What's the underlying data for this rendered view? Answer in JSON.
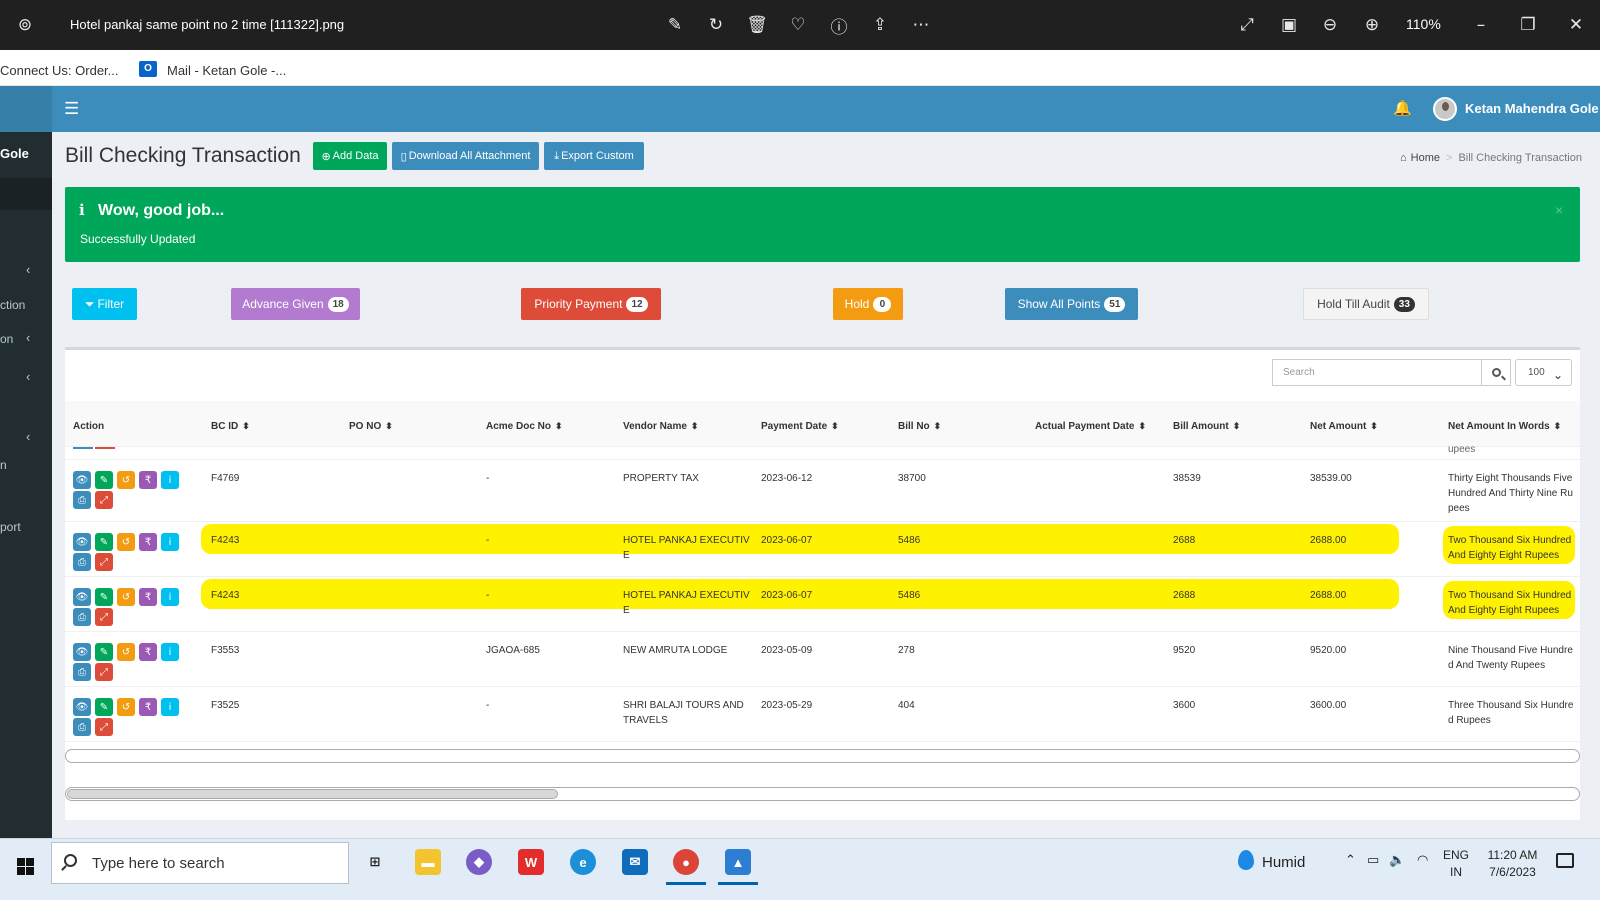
{
  "viewer": {
    "file_name": "Hotel pankaj same point no 2 time [111322].png",
    "zoom": "110%"
  },
  "bookmarks": [
    {
      "label": "Connect Us: Order..."
    },
    {
      "label": "Mail - Ketan Gole -..."
    }
  ],
  "sidebar": {
    "user_label": "Gole",
    "items": [
      {
        "label": "ction"
      },
      {
        "label": "on"
      },
      {
        "label": "n"
      },
      {
        "label": "port"
      }
    ]
  },
  "topbar": {
    "user_name": "Ketan Mahendra Gole"
  },
  "page": {
    "title": "Bill Checking Transaction",
    "buttons": {
      "add_data": "Add Data",
      "download_all": "Download All Attachment",
      "export_custom": "Export Custom"
    },
    "breadcrumb": {
      "home": "Home",
      "current": "Bill Checking Transaction"
    }
  },
  "alert": {
    "title": "Wow, good job...",
    "message": "Successfully Updated",
    "close": "×"
  },
  "filters": {
    "filter": {
      "label": "Filter",
      "color": "#00c0ef"
    },
    "advance_given": {
      "label": "Advance Given",
      "count": "18",
      "color": "#b37bd0"
    },
    "priority_payment": {
      "label": "Priority Payment",
      "count": "12",
      "color": "#dd4b39"
    },
    "hold": {
      "label": "Hold",
      "count": "0",
      "color": "#f39c12"
    },
    "show_all_points": {
      "label": "Show All Points",
      "count": "51",
      "color": "#3c8dbc"
    },
    "hold_till_audit": {
      "label": "Hold Till Audit",
      "count": "33",
      "color": "#f4f4f4"
    }
  },
  "table": {
    "search_placeholder": "Search",
    "page_length": "100",
    "columns": [
      "Action",
      "BC ID",
      "PO NO",
      "Acme Doc No",
      "Vendor Name",
      "Payment Date",
      "Bill No",
      "Actual Payment Date",
      "Bill Amount",
      "Net Amount",
      "Net Amount In Words"
    ],
    "partial_row_text": "upees",
    "rows": [
      {
        "bc_id": "F4769",
        "po_no": "",
        "acme_doc_no": "-",
        "vendor_name": "PROPERTY TAX",
        "payment_date": "2023-06-12",
        "bill_no": "38700",
        "actual_payment_date": "",
        "bill_amount": "38539",
        "net_amount": "38539.00",
        "net_amount_words": "Thirty Eight Thousands Five Hundred And Thirty Nine Rupees",
        "highlighted": false
      },
      {
        "bc_id": "F4243",
        "po_no": "",
        "acme_doc_no": "-",
        "vendor_name": "HOTEL PANKAJ EXECUTIVE",
        "payment_date": "2023-06-07",
        "bill_no": "5486",
        "actual_payment_date": "",
        "bill_amount": "2688",
        "net_amount": "2688.00",
        "net_amount_words": "Two Thousand Six Hundred And Eighty Eight Rupees",
        "highlighted": true
      },
      {
        "bc_id": "F4243",
        "po_no": "",
        "acme_doc_no": "-",
        "vendor_name": "HOTEL PANKAJ EXECUTIVE",
        "payment_date": "2023-06-07",
        "bill_no": "5486",
        "actual_payment_date": "",
        "bill_amount": "2688",
        "net_amount": "2688.00",
        "net_amount_words": "Two Thousand Six Hundred And Eighty Eight Rupees",
        "highlighted": true
      },
      {
        "bc_id": "F3553",
        "po_no": "",
        "acme_doc_no": "JGAOA-685",
        "vendor_name": "NEW AMRUTA LODGE",
        "payment_date": "2023-05-09",
        "bill_no": "278",
        "actual_payment_date": "",
        "bill_amount": "9520",
        "net_amount": "9520.00",
        "net_amount_words": "Nine Thousand Five Hundred And Twenty Rupees",
        "highlighted": false
      },
      {
        "bc_id": "F3525",
        "po_no": "",
        "acme_doc_no": "-",
        "vendor_name": "SHRI BALAJI TOURS AND TRAVELS",
        "payment_date": "2023-05-29",
        "bill_no": "404",
        "actual_payment_date": "",
        "bill_amount": "3600",
        "net_amount": "3600.00",
        "net_amount_words": "Three Thousand Six Hundred Rupees",
        "highlighted": false
      }
    ],
    "action_icons": [
      "view-icon",
      "edit-icon",
      "undo-icon",
      "rupee-icon",
      "info-icon",
      "print-icon",
      "expand-icon"
    ]
  },
  "taskbar": {
    "search_placeholder": "Type here to search",
    "weather": "Humid",
    "language": "ENG",
    "region": "IN",
    "time": "11:20 AM",
    "date": "7/6/2023"
  }
}
